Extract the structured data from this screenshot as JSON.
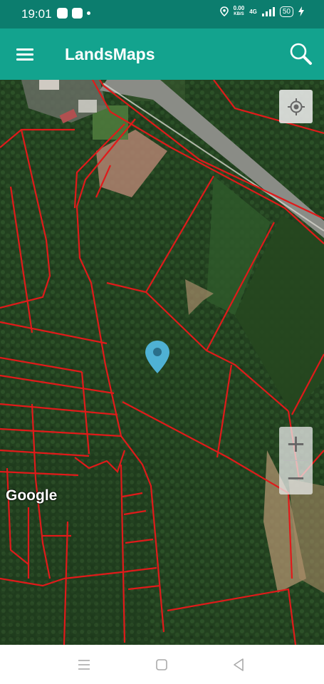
{
  "status_bar": {
    "time": "19:01",
    "net_speed_value": "0.00",
    "net_speed_unit": "KB/S",
    "network_type": "4G",
    "battery_level": "50"
  },
  "app_bar": {
    "title": "LandsMaps",
    "menu_icon": "hamburger-menu-icon",
    "search_icon": "magnifier-icon"
  },
  "map": {
    "attribution": "Google",
    "zoom_in_label": "+",
    "zoom_out_label": "−",
    "locate_icon": "my-location-icon",
    "marker_icon": "map-pin-icon",
    "marker_color": "#4fb1d4",
    "parcel_line_color": "#e01a1a"
  },
  "nav_bar": {
    "recents_icon": "recents-icon",
    "home_icon": "home-icon",
    "back_icon": "back-icon"
  }
}
